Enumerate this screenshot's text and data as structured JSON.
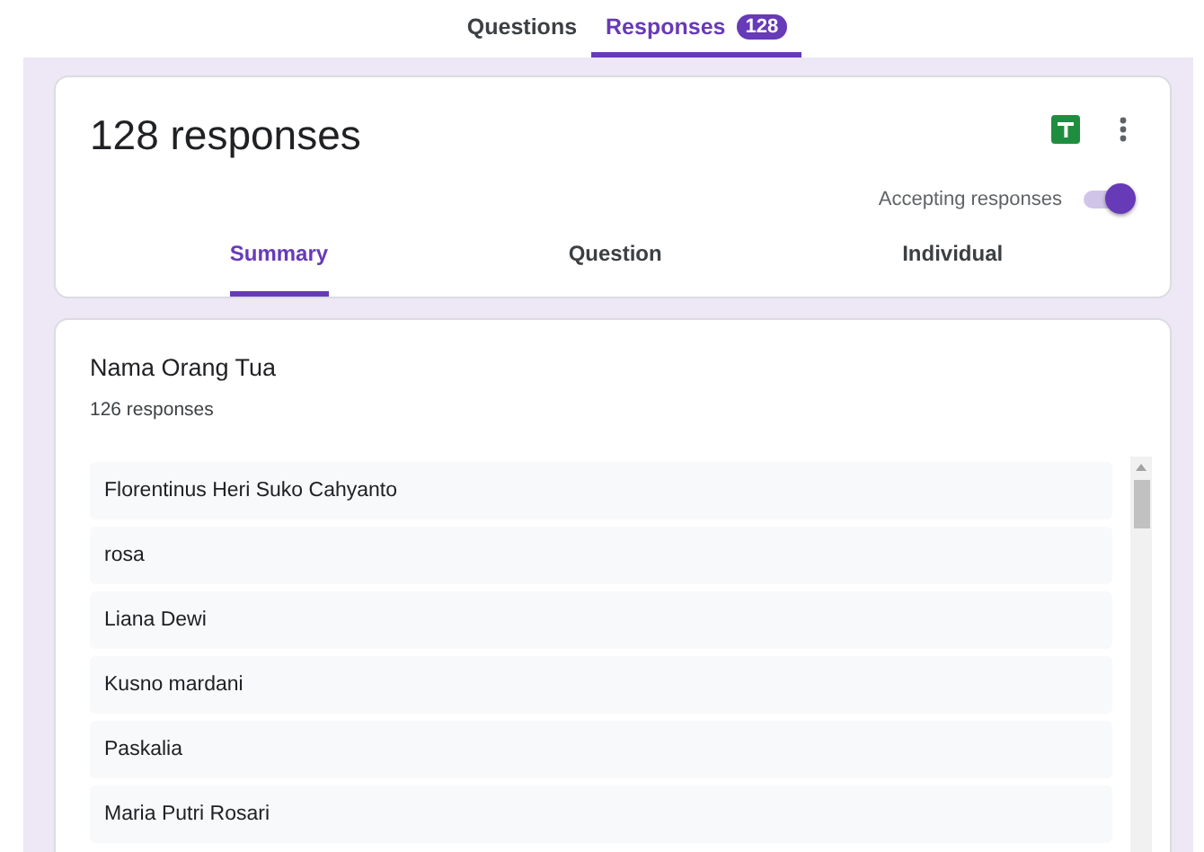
{
  "top_tabs": [
    {
      "label": "Questions",
      "selected": false
    },
    {
      "label": "Responses",
      "selected": true,
      "badge": "128"
    }
  ],
  "header": {
    "title": "128 responses",
    "accepting": {
      "label": "Accepting responses",
      "on": true
    }
  },
  "view_tabs": [
    {
      "label": "Summary",
      "selected": true
    },
    {
      "label": "Question",
      "selected": false
    },
    {
      "label": "Individual",
      "selected": false
    }
  ],
  "question": {
    "title": "Nama Orang Tua",
    "count": "126 responses",
    "answers": [
      "Florentinus Heri Suko Cahyanto",
      "rosa",
      "Liana Dewi",
      "Kusno mardani",
      "Paskalia",
      "Maria Putri Rosari"
    ]
  }
}
